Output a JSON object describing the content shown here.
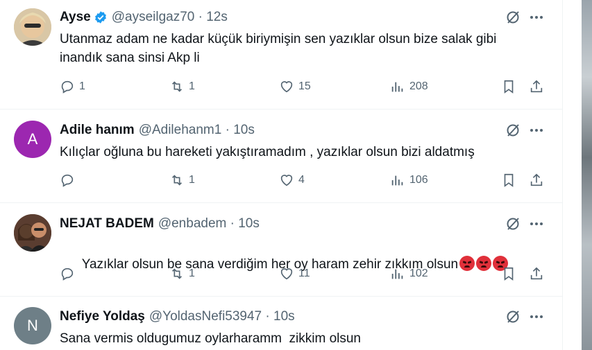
{
  "tweets": [
    {
      "name": "Ayse",
      "handle": "@ayseilgaz70 · 12s",
      "verified": true,
      "text": "Utanmaz adam ne kadar küçük biriymişin sen yazıklar olsun bize salak gibi\ninandık sana sinsi Akp li",
      "replies": "1",
      "reposts": "1",
      "likes": "15",
      "views": "208",
      "avatar_letter": ""
    },
    {
      "name": "Adile hanım",
      "handle": "@Adilehanm1 · 10s",
      "verified": false,
      "text": "Kılıçlar oğluna bu hareketi yakıştıramadım , yazıklar olsun bizi aldatmış",
      "replies": "",
      "reposts": "1",
      "likes": "4",
      "views": "106",
      "avatar_letter": "A"
    },
    {
      "name": "NEJAT BADEM",
      "handle": "@enbadem · 10s",
      "verified": false,
      "text": "Yazıklar olsun be sana verdiğim her oy haram zehir zıkkım olsun",
      "replies": "",
      "reposts": "1",
      "likes": "11",
      "views": "102",
      "avatar_letter": ""
    },
    {
      "name": "Nefiye Yoldaş",
      "handle": "@YoldasNefi53947 · 10s",
      "verified": false,
      "text": "Sana vermis oldugumuz oylarharamm  zikkim olsun",
      "replies": "",
      "reposts": "",
      "likes": "",
      "views": "",
      "avatar_letter": "N"
    }
  ],
  "colors": {
    "text": "#0f1419",
    "secondary": "#536471",
    "verified": "#1d9bf0",
    "avatar_purple": "#9c27b0",
    "avatar_gray": "#6e7f87",
    "emoji_red": "#e0303a"
  },
  "icons": [
    "verified-badge-icon",
    "grok-icon",
    "more-icon",
    "reply-icon",
    "repost-icon",
    "like-icon",
    "views-icon",
    "bookmark-icon",
    "share-icon",
    "angry-face-emoji"
  ]
}
